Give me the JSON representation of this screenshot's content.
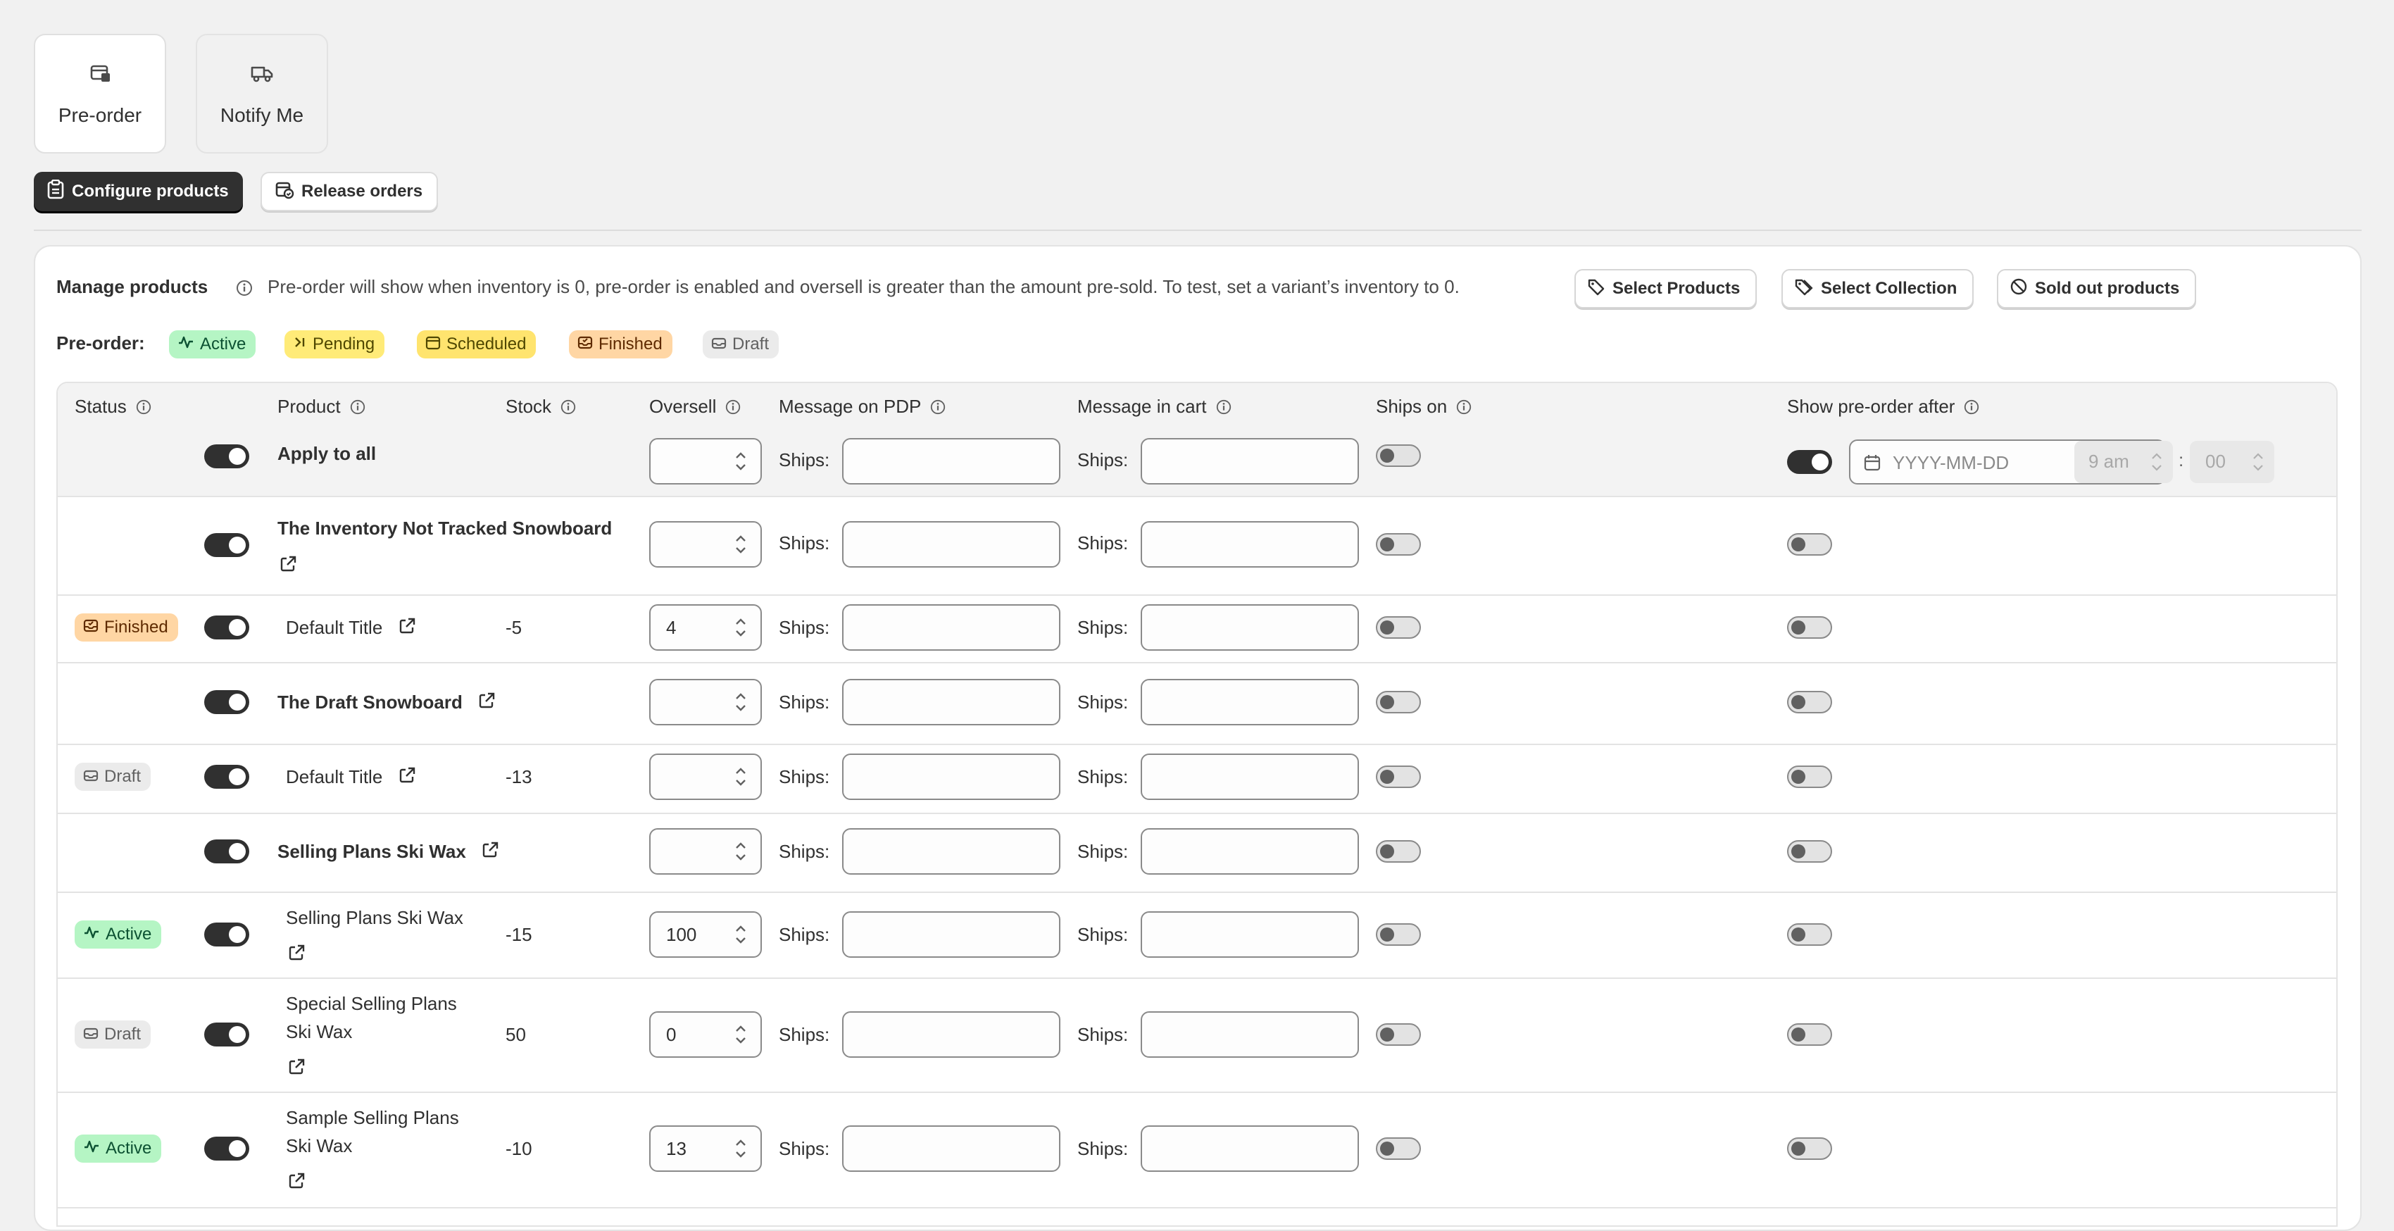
{
  "tabs": [
    {
      "label": "Pre-order",
      "icon": "preorder-icon"
    },
    {
      "label": "Notify Me",
      "icon": "truck-icon"
    }
  ],
  "subnav": {
    "configure": "Configure products",
    "release": "Release orders"
  },
  "manage": {
    "title": "Manage products",
    "info": "Pre-order will show when inventory is 0, pre-order is enabled and oversell is greater than the amount pre-sold. To test, set a variant’s inventory to 0.",
    "select_products": "Select Products",
    "select_collection": "Select Collection",
    "sold_out": "Sold out products"
  },
  "legend": {
    "label": "Pre-order:",
    "active": "Active",
    "pending": "Pending",
    "scheduled": "Scheduled",
    "finished": "Finished",
    "draft": "Draft"
  },
  "table": {
    "headers": {
      "status": "Status",
      "product": "Product",
      "stock": "Stock",
      "oversell": "Oversell",
      "msg_pdp": "Message on PDP",
      "msg_cart": "Message in cart",
      "ships_on": "Ships on",
      "show_after": "Show pre-order after"
    },
    "apply_all": "Apply to all",
    "ships": "Ships:",
    "date_placeholder": "YYYY-MM-DD",
    "hour": "9 am",
    "colon": ":",
    "minute": "00",
    "rows": [
      {
        "status": "",
        "product": "The Inventory Not Tracked Snowboard",
        "stock": "",
        "oversell": ""
      },
      {
        "status": "Finished",
        "product": "Default Title",
        "stock": "-5",
        "oversell": "4"
      },
      {
        "status": "",
        "product": "The Draft Snowboard",
        "stock": "",
        "oversell": ""
      },
      {
        "status": "Draft",
        "product": "Default Title",
        "stock": "-13",
        "oversell": ""
      },
      {
        "status": "",
        "product": "Selling Plans Ski Wax",
        "stock": "",
        "oversell": ""
      },
      {
        "status": "Active",
        "product_line1": "Selling Plans Ski Wax",
        "stock": "-15",
        "oversell": "100"
      },
      {
        "status": "Draft",
        "product_line1": "Special Selling Plans",
        "product_line2": "Ski Wax",
        "stock": "50",
        "oversell": "0"
      },
      {
        "status": "Active",
        "product_line1": "Sample Selling Plans",
        "product_line2": "Ski Wax",
        "stock": "-10",
        "oversell": "13"
      }
    ]
  }
}
